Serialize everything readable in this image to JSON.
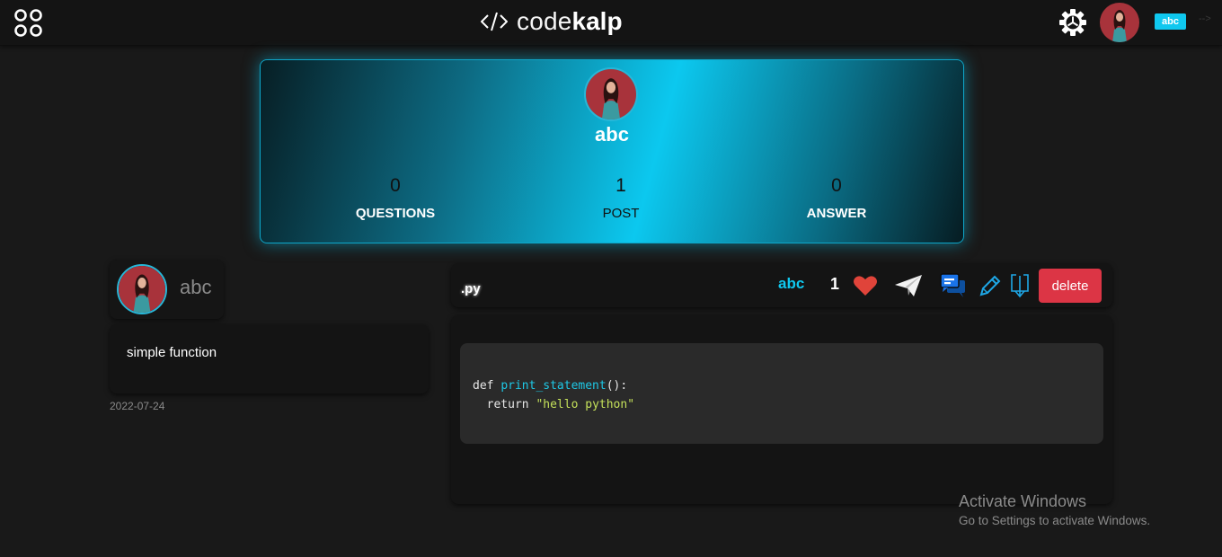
{
  "header": {
    "brand_code": "code",
    "brand_kalp": "kalp",
    "user_badge": "abc",
    "arrow": "-->"
  },
  "profile": {
    "name": "abc",
    "stats": [
      {
        "value": "0",
        "label": "QUESTIONS"
      },
      {
        "value": "1",
        "label": "POST"
      },
      {
        "value": "0",
        "label": "ANSWER"
      }
    ]
  },
  "post": {
    "author": "abc",
    "title": "simple function",
    "date": "2022-07-24",
    "language": ".py",
    "toolbar_user": "abc",
    "likes": "1",
    "delete_label": "delete",
    "code": {
      "line1_kw": "def ",
      "line1_fn": "print_statement",
      "line1_rest": "():",
      "line2_kw": "  return ",
      "line2_str": "\"hello python\""
    }
  },
  "watermark": {
    "title": "Activate Windows",
    "subtitle": "Go to Settings to activate Windows."
  },
  "colors": {
    "accent": "#0fc8ef",
    "delete": "#dc3545",
    "heart": "#e0443a",
    "background": "#191919"
  },
  "icons": [
    "menu-grid-icon",
    "gear-icon",
    "heart-icon",
    "paper-plane-icon",
    "comments-icon",
    "pencil-icon",
    "download-icon"
  ]
}
